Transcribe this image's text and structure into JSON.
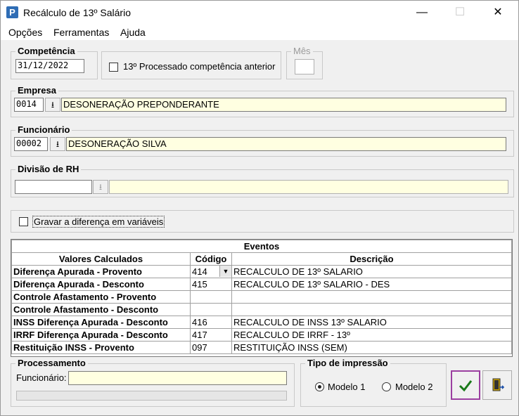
{
  "window": {
    "title": "Recálculo de 13º Salário",
    "app_icon": "P",
    "minimize": "—",
    "maximize": "☐",
    "close": "✕"
  },
  "menu": [
    "Opções",
    "Ferramentas",
    "Ajuda"
  ],
  "competencia": {
    "label": "Competência",
    "value": "31/12/2022"
  },
  "processado": {
    "label": "13º Processado competência anterior",
    "checked": false
  },
  "mes": {
    "label": "Mês",
    "value": ""
  },
  "empresa": {
    "label": "Empresa",
    "code": "0014",
    "name": "DESONERAÇÃO PREPONDERANTE"
  },
  "funcionario": {
    "label": "Funcionário",
    "code": "00002",
    "name": "DESONERAÇÃO SILVA"
  },
  "divisao": {
    "label": "Divisão de RH",
    "code": "",
    "name": ""
  },
  "gravar": {
    "label": "Gravar a diferença em variáveis",
    "checked": false
  },
  "eventos": {
    "title": "Eventos",
    "columns": [
      "Valores Calculados",
      "Código",
      "Descrição"
    ],
    "rows": [
      {
        "valor": "Diferença Apurada - Provento",
        "codigo": "414",
        "descricao": "RECALCULO DE 13º SALARIO"
      },
      {
        "valor": "Diferença Apurada - Desconto",
        "codigo": "415",
        "descricao": "RECALCULO DE 13º SALARIO - DES"
      },
      {
        "valor": "Controle Afastamento - Provento",
        "codigo": "",
        "descricao": ""
      },
      {
        "valor": "Controle Afastamento - Desconto",
        "codigo": "",
        "descricao": ""
      },
      {
        "valor": "INSS Diferença Apurada - Desconto",
        "codigo": "416",
        "descricao": "RECALCULO DE INSS 13º SALARIO"
      },
      {
        "valor": "IRRF Diferença Apurada - Desconto",
        "codigo": "417",
        "descricao": "RECALCULO DE IRRF - 13º"
      },
      {
        "valor": "Restituição INSS - Provento",
        "codigo": "097",
        "descricao": "RESTITUIÇÃO INSS (SEM)"
      }
    ]
  },
  "processamento": {
    "label": "Processamento",
    "funcionario_label": "Funcionário:",
    "funcionario_value": ""
  },
  "tipo_impressao": {
    "label": "Tipo de impressão",
    "options": [
      "Modelo 1",
      "Modelo 2"
    ],
    "selected": "Modelo 1"
  },
  "buttons": {
    "confirm_icon": "checkmark-icon",
    "exit_icon": "exit-door-icon"
  }
}
